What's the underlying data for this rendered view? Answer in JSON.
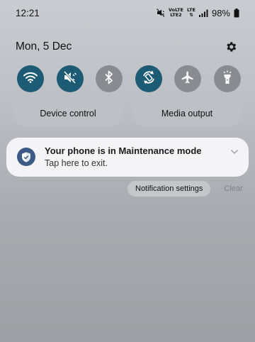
{
  "status_bar": {
    "time": "12:21",
    "net_top": "VoLTE",
    "net_bottom": "LTE2",
    "lte": "LTE",
    "battery": "98%"
  },
  "header": {
    "date": "Mon, 5 Dec",
    "settings_icon": "gear-icon"
  },
  "quick_settings": {
    "tiles": [
      {
        "name": "wifi",
        "icon": "wifi-icon",
        "state": "on"
      },
      {
        "name": "sound",
        "icon": "mute-vibrate-icon",
        "state": "on"
      },
      {
        "name": "bluetooth",
        "icon": "bluetooth-icon",
        "state": "off"
      },
      {
        "name": "auto-rotate",
        "icon": "auto-rotate-icon",
        "state": "on"
      },
      {
        "name": "airplane",
        "icon": "airplane-icon",
        "state": "off"
      },
      {
        "name": "flashlight",
        "icon": "flashlight-icon",
        "state": "off"
      }
    ],
    "device_control_label": "Device control",
    "media_output_label": "Media output"
  },
  "notification": {
    "title": "Your phone is in Maintenance mode",
    "body": "Tap here to exit.",
    "icon": "shield-icon"
  },
  "actions": {
    "settings_label": "Notification settings",
    "clear_label": "Clear"
  },
  "colors": {
    "tile_on": "#1d5b74",
    "tile_off": "#888b90",
    "notif_icon_bg": "#3c5a86"
  }
}
